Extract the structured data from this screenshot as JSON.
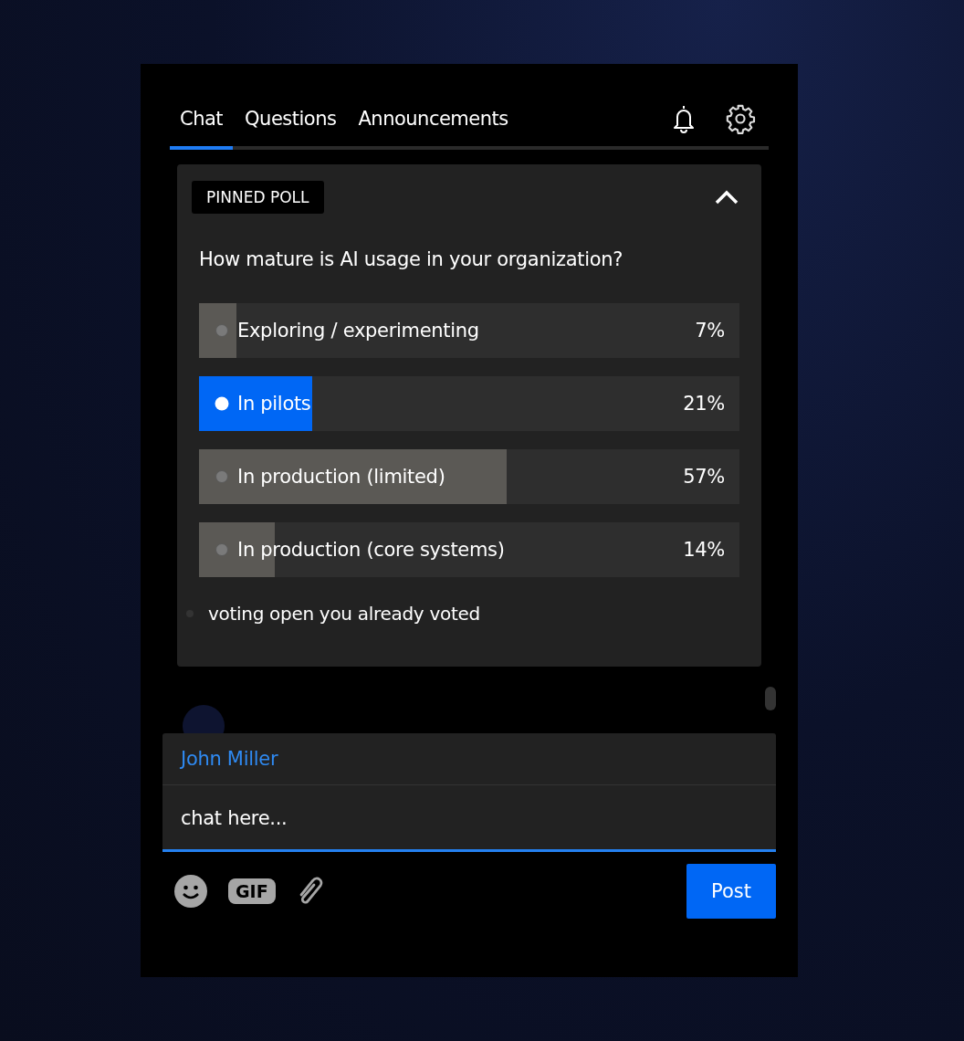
{
  "tabs": [
    {
      "label": "Chat",
      "selected": true
    },
    {
      "label": "Questions",
      "selected": false
    },
    {
      "label": "Announcements",
      "selected": false
    }
  ],
  "poll": {
    "badge": "PINNED POLL",
    "expanded": true,
    "question": "How mature is AI usage in your organization?",
    "options": [
      {
        "label": "Exploring / experimenting",
        "percent": "7%",
        "level": 0.07,
        "selected": false
      },
      {
        "label": "In pilots",
        "percent": "21%",
        "level": 0.21,
        "selected": true
      },
      {
        "label": "In production (limited)",
        "percent": "57%",
        "level": 0.57,
        "selected": false
      },
      {
        "label": "In production (core systems)",
        "percent": "14%",
        "level": 0.14,
        "selected": false
      }
    ],
    "status": "voting open you already voted"
  },
  "composer": {
    "user": "John Miller",
    "placeholder": "chat here...",
    "gif_label": "GIF",
    "post_button": "Post"
  }
}
